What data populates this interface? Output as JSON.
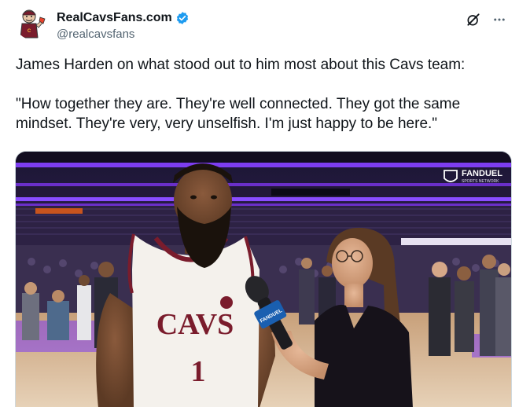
{
  "author": {
    "display_name": "RealCavsFans.com",
    "handle": "@realcavsfans",
    "verified": true,
    "verified_color": "#1d9bf0",
    "avatar_icon": "cartoon-fan-avatar"
  },
  "actions": {
    "grok_icon": "grok-icon",
    "more_icon": "more-dots-icon"
  },
  "tweet": {
    "line1": "James Harden on what stood out to him most about this Cavs team:",
    "line2": "\"How together they are. They're well connected. They got the same mindset. They're very, very unselfish. I'm just happy to be here.\""
  },
  "media": {
    "broadcaster_logo": "FANDUEL",
    "broadcaster_sub": "SPORTS NETWORK",
    "jersey_team": "CAVS",
    "jersey_number": "1",
    "mic_flag": "FANDUEL",
    "arena_color": "#6a2fc9"
  }
}
